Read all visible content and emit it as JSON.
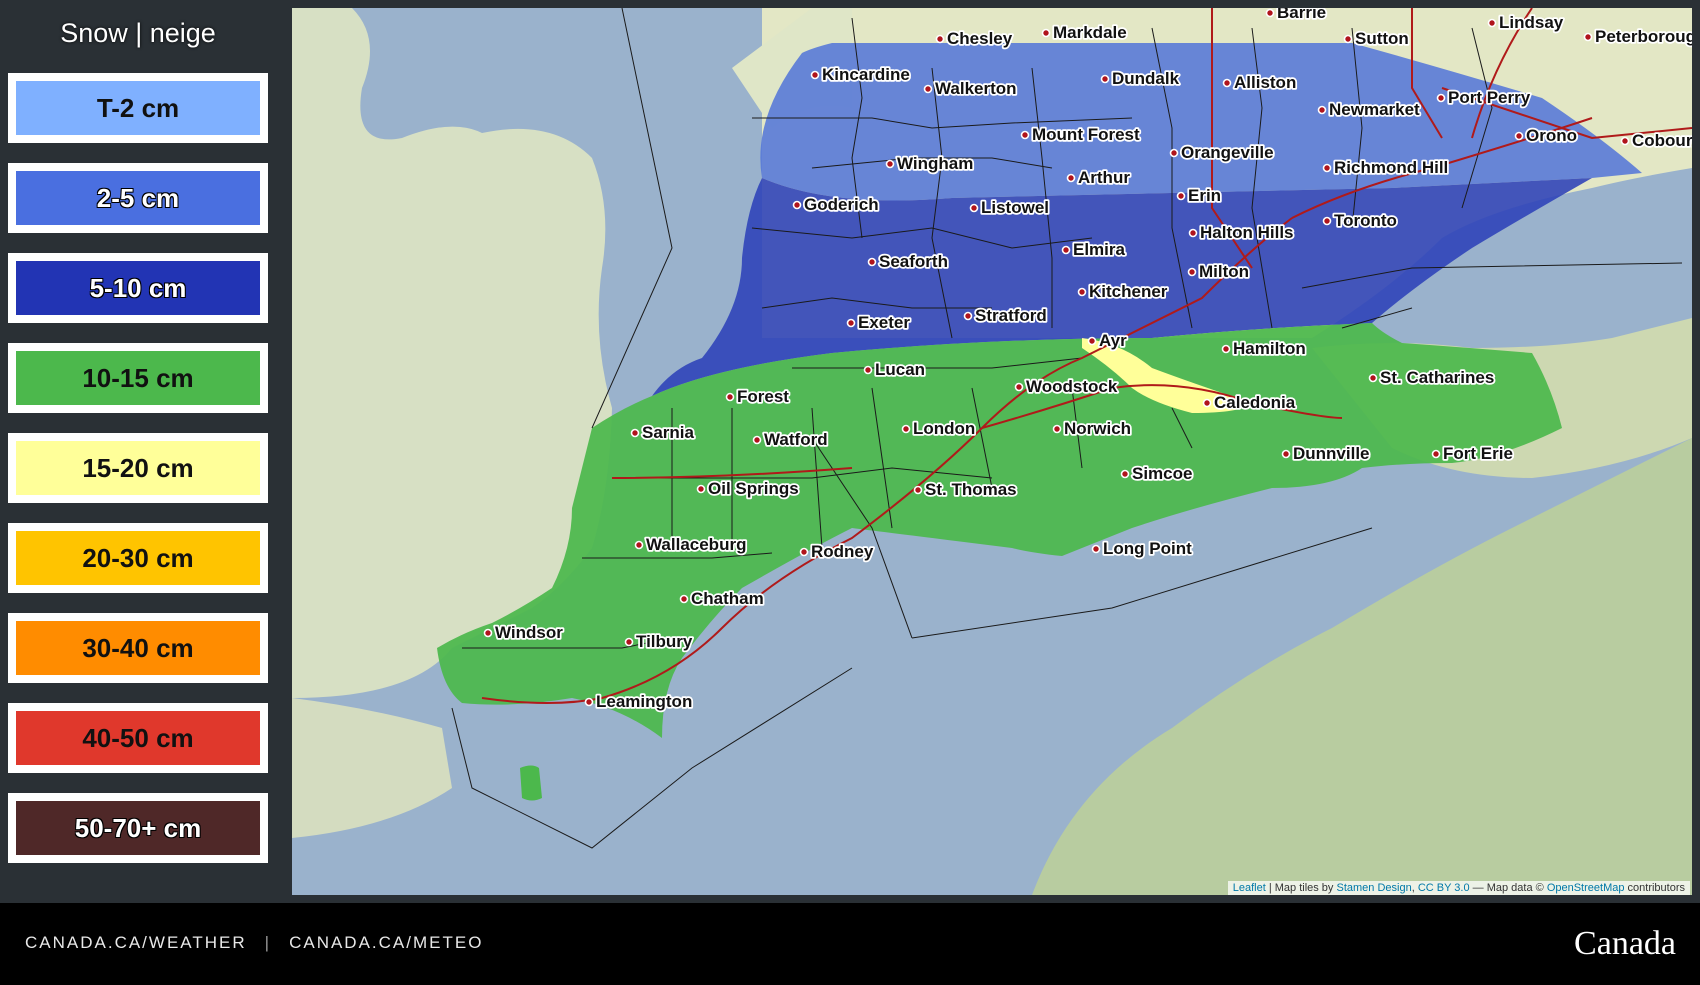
{
  "legend": {
    "title": "Snow | neige",
    "items": [
      {
        "label": "T-2 cm",
        "color": "#7fb0ff",
        "light_text": false
      },
      {
        "label": "2-5 cm",
        "color": "#4a6fe0",
        "light_text": true
      },
      {
        "label": "5-10 cm",
        "color": "#2234b4",
        "light_text": true
      },
      {
        "label": "10-15 cm",
        "color": "#4cb84c",
        "light_text": false
      },
      {
        "label": "15-20 cm",
        "color": "#ffff99",
        "light_text": false
      },
      {
        "label": "20-30 cm",
        "color": "#ffc400",
        "light_text": false
      },
      {
        "label": "30-40 cm",
        "color": "#ff8c00",
        "light_text": false
      },
      {
        "label": "40-50 cm",
        "color": "#e0382c",
        "light_text": false
      },
      {
        "label": "50-70+ cm",
        "color": "#4f2828",
        "light_text": true
      }
    ]
  },
  "map": {
    "cities": [
      {
        "name": "Barrie"
      },
      {
        "name": "Lindsay"
      },
      {
        "name": "Peterborough"
      },
      {
        "name": "Sutton"
      },
      {
        "name": "Markdale"
      },
      {
        "name": "Chesley"
      },
      {
        "name": "Kincardine"
      },
      {
        "name": "Walkerton"
      },
      {
        "name": "Dundalk"
      },
      {
        "name": "Alliston"
      },
      {
        "name": "Port Perry"
      },
      {
        "name": "Newmarket"
      },
      {
        "name": "Orono"
      },
      {
        "name": "Cobourg"
      },
      {
        "name": "Mount Forest"
      },
      {
        "name": "Orangeville"
      },
      {
        "name": "Richmond Hill"
      },
      {
        "name": "Wingham"
      },
      {
        "name": "Arthur"
      },
      {
        "name": "Goderich"
      },
      {
        "name": "Listowel"
      },
      {
        "name": "Erin"
      },
      {
        "name": "Toronto"
      },
      {
        "name": "Halton Hills"
      },
      {
        "name": "Elmira"
      },
      {
        "name": "Seaforth"
      },
      {
        "name": "Milton"
      },
      {
        "name": "Kitchener"
      },
      {
        "name": "Stratford"
      },
      {
        "name": "Exeter"
      },
      {
        "name": "Ayr"
      },
      {
        "name": "Hamilton"
      },
      {
        "name": "Lucan"
      },
      {
        "name": "St. Catharines"
      },
      {
        "name": "Woodstock"
      },
      {
        "name": "Forest"
      },
      {
        "name": "Caledonia"
      },
      {
        "name": "Sarnia"
      },
      {
        "name": "Watford"
      },
      {
        "name": "London"
      },
      {
        "name": "Norwich"
      },
      {
        "name": "Dunnville"
      },
      {
        "name": "Fort Erie"
      },
      {
        "name": "Simcoe"
      },
      {
        "name": "Oil Springs"
      },
      {
        "name": "St. Thomas"
      },
      {
        "name": "Wallaceburg"
      },
      {
        "name": "Rodney"
      },
      {
        "name": "Long Point"
      },
      {
        "name": "Chatham"
      },
      {
        "name": "Windsor"
      },
      {
        "name": "Tilbury"
      },
      {
        "name": "Leamington"
      }
    ],
    "attribution": {
      "leaflet": "Leaflet",
      "tiles_prefix": " | Map tiles by ",
      "stamen": "Stamen Design",
      "comma": ", ",
      "license": "CC BY 3.0",
      "data_prefix": " — Map data © ",
      "osm": "OpenStreetMap",
      "suffix": " contributors"
    }
  },
  "footer": {
    "link_en": "CANADA.CA/WEATHER",
    "separator": "|",
    "link_fr": "CANADA.CA/METEO",
    "wordmark": "Canada"
  }
}
